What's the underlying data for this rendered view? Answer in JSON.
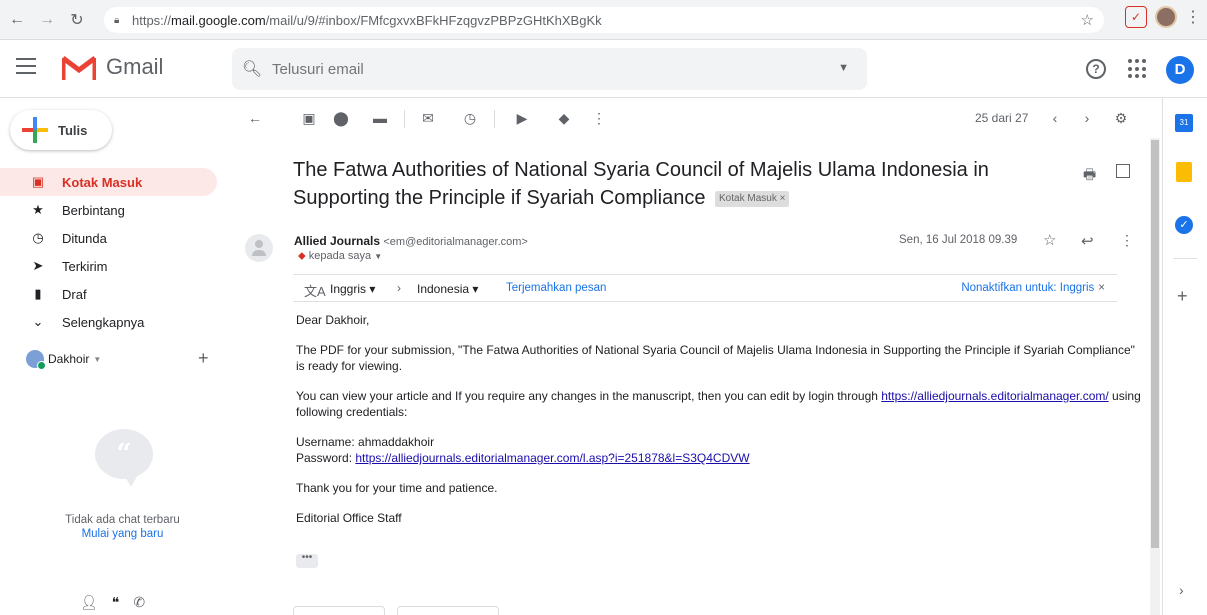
{
  "browser": {
    "url_prefix": "https://",
    "url_host": "mail.google.com",
    "url_rest": "/mail/u/9/#inbox/FMfcgxvxBFkHFzqgvzPBPzGHtKhXBgKk"
  },
  "header": {
    "app_name": "Gmail",
    "search_placeholder": "Telusuri email",
    "account_initial": "D"
  },
  "nav": {
    "compose_label": "Tulis",
    "items": [
      {
        "label": "Kotak Masuk"
      },
      {
        "label": "Berbintang"
      },
      {
        "label": "Ditunda"
      },
      {
        "label": "Terkirim"
      },
      {
        "label": "Draf"
      },
      {
        "label": "Selengkapnya"
      }
    ],
    "hangouts_user": "Dakhoir",
    "no_chat_text": "Tidak ada chat terbaru",
    "start_new_text": "Mulai yang baru"
  },
  "toolbar": {
    "pager": "25 dari 27"
  },
  "email": {
    "subject": "The Fatwa Authorities of National Syaria Council of Majelis Ulama Indonesia in Supporting the Principle if Syariah Compliance",
    "label_chip": "Kotak Masuk ×",
    "sender_name": "Allied Journals",
    "sender_email": "<em@editorialmanager.com>",
    "to_text": "kepada saya",
    "date": "Sen, 16 Jul 2018 09.39",
    "translate": {
      "from_lang": "Inggris",
      "to_lang": "Indonesia",
      "translate_link": "Terjemahkan pesan",
      "disable_text": "Nonaktifkan untuk: Inggris"
    },
    "body": {
      "greeting": "Dear  Dakhoir,",
      "para1": "The PDF for your submission, \"The Fatwa Authorities of National Syaria Council of Majelis Ulama Indonesia in Supporting the Principle if Syariah Compliance\" is ready for viewing.",
      "para2_before": "You can view your article and If you require any changes in the manuscript, then you can edit by login through ",
      "para2_link": "https://alliedjournals.editorialmanager.com/",
      "para2_after": " using following credentials:",
      "username_line": "Username: ahmaddakhoir",
      "password_label": "Password: ",
      "password_link": "https://alliedjournals.editorialmanager.com/l.asp?i=251878&l=S3Q4CDVW",
      "thanks": "Thank you for your time and patience.",
      "signature": "Editorial Office Staff"
    },
    "ellipsis": "•••"
  },
  "rail": {
    "calendar_day": "31"
  },
  "colors": {
    "accent_red": "#d93025",
    "active_bg": "#fce8e6",
    "link_blue": "#1a73e8"
  }
}
